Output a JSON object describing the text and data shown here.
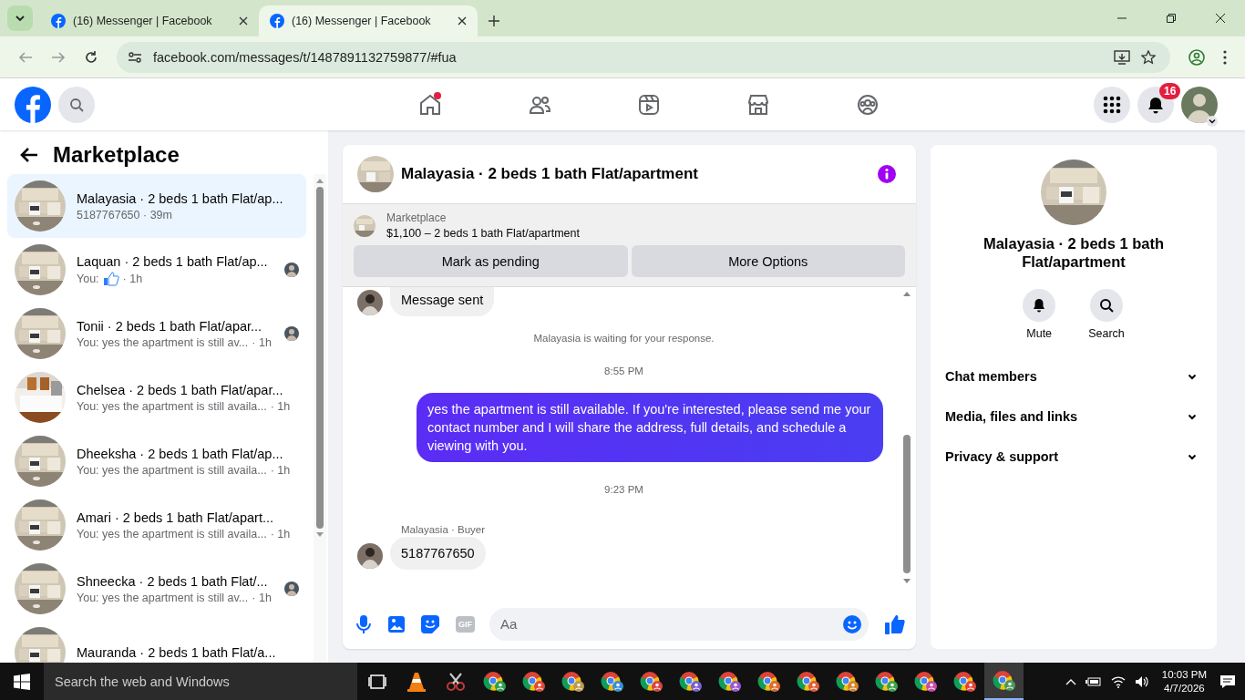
{
  "browser": {
    "tabs": [
      {
        "title": "(16) Messenger | Facebook",
        "selected": false
      },
      {
        "title": "(16) Messenger | Facebook",
        "selected": true
      }
    ],
    "url": "facebook.com/messages/t/1487891132759877/#fua"
  },
  "navbar": {
    "items": [
      {
        "kind": "home",
        "dot": true
      },
      {
        "kind": "friends",
        "dot": false
      },
      {
        "kind": "video",
        "dot": false
      },
      {
        "kind": "marketplace",
        "dot": false
      },
      {
        "kind": "groups",
        "dot": false
      }
    ],
    "notifications": "16"
  },
  "sidebar": {
    "title": "Marketplace",
    "conversations": [
      {
        "title": "Malayasia · 2 beds 1 bath Flat/ap...",
        "kind": "text",
        "preview": "5187767650 · 39m",
        "selected": true,
        "seen": false
      },
      {
        "title": "Laquan · 2 beds 1 bath Flat/ap...",
        "kind": "like",
        "preview": "You:",
        "time": "· 1h",
        "selected": false,
        "seen": true
      },
      {
        "title": "Tonii · 2 beds 1 bath Flat/apar...",
        "kind": "text",
        "preview": "You: yes the apartment is still av...",
        "time": "· 1h",
        "selected": false,
        "seen": true
      },
      {
        "title": "Chelsea · 2 beds 1 bath Flat/apar...",
        "kind": "text",
        "preview": "You: yes the apartment is still availa...",
        "time": "· 1h",
        "selected": false,
        "seen": false
      },
      {
        "title": "Dheeksha · 2 beds 1 bath Flat/ap...",
        "kind": "text",
        "preview": "You: yes the apartment is still availa...",
        "time": "· 1h",
        "selected": false,
        "seen": false
      },
      {
        "title": "Amari · 2 beds 1 bath Flat/apart...",
        "kind": "text",
        "preview": "You: yes the apartment is still availa...",
        "time": "· 1h",
        "selected": false,
        "seen": false
      },
      {
        "title": "Shneecka · 2 beds 1 bath Flat/...",
        "kind": "text",
        "preview": "You: yes the apartment is still av...",
        "time": "· 1h",
        "selected": false,
        "seen": true
      },
      {
        "title": "Mauranda · 2 beds 1 bath Flat/a...",
        "kind": "title"
      }
    ]
  },
  "chat": {
    "title": "Malayasia · 2 beds 1 bath Flat/apartment",
    "listing": {
      "label": "Marketplace",
      "title": "$1,100 – 2 beds 1 bath Flat/apartment",
      "buttons": [
        "Mark as pending",
        "More Options"
      ]
    },
    "messages": [
      {
        "kind": "received",
        "text": "Message sent"
      },
      {
        "kind": "notice",
        "text": "Malayasia is waiting for your response."
      },
      {
        "kind": "time",
        "text": "8:55 PM"
      },
      {
        "kind": "sent",
        "text": "yes the apartment is still available. If you're interested, please send me your contact number and I will share the address, full details, and schedule a viewing with you."
      },
      {
        "kind": "time",
        "text": "9:23 PM"
      },
      {
        "kind": "received",
        "sender": "Malayasia · Buyer",
        "text": "5187767650"
      }
    ],
    "composer": {
      "placeholder": "Aa",
      "gif_label": "GIF"
    }
  },
  "details": {
    "title": "Malayasia · 2 beds 1 bath Flat/apartment",
    "actions": [
      {
        "kind": "bell",
        "label": "Mute"
      },
      {
        "kind": "search",
        "label": "Search"
      }
    ],
    "sections": [
      "Chat members",
      "Media, files and links",
      "Privacy & support"
    ]
  },
  "taskbar": {
    "search_placeholder": "Search the web and Windows",
    "apps": [
      {
        "kind": "taskview",
        "selected": false
      },
      {
        "kind": "cone",
        "selected": false
      },
      {
        "kind": "scissors",
        "selected": false
      },
      {
        "kind": "chrome",
        "color": "#2e9e4f",
        "selected": false
      },
      {
        "kind": "chrome",
        "color": "#e04a3a",
        "selected": false
      },
      {
        "kind": "chrome",
        "color": "#b89a52",
        "selected": false
      },
      {
        "kind": "chrome",
        "color": "#3b8fd6",
        "selected": false
      },
      {
        "kind": "chrome",
        "color": "#d84545",
        "selected": false
      },
      {
        "kind": "chrome",
        "color": "#7a5fd1",
        "selected": false
      },
      {
        "kind": "chrome",
        "color": "#9b59d0",
        "selected": false
      },
      {
        "kind": "chrome",
        "color": "#e06a2e",
        "selected": false
      },
      {
        "kind": "chrome",
        "color": "#e35d3b",
        "selected": false
      },
      {
        "kind": "chrome",
        "color": "#d9822b",
        "selected": false
      },
      {
        "kind": "chrome",
        "color": "#3fa34d",
        "selected": false
      },
      {
        "kind": "chrome",
        "color": "#c84aa8",
        "selected": false
      },
      {
        "kind": "chrome",
        "color": "#e0453a",
        "selected": false
      },
      {
        "kind": "chrome",
        "color": "#4c9a5a",
        "selected": true
      }
    ],
    "time": "10:03 PM",
    "date": "4/7/2026"
  }
}
